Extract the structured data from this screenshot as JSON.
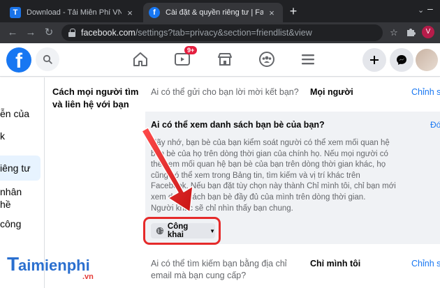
{
  "browser": {
    "tabs": [
      {
        "title": "Download - Tải Miễn Phí VN - Ph",
        "favicon": "T",
        "active": false
      },
      {
        "title": "Cài đặt & quyền riêng tư | Faceb",
        "favicon": "f",
        "active": true
      }
    ],
    "new_tab": "+",
    "close_glyph": "×",
    "url_host": "facebook.com",
    "url_path": "/settings?tab=privacy&section=friendlist&view",
    "profile_initial": "V"
  },
  "fb_header": {
    "logo": "f",
    "watch_badge": "9+"
  },
  "sidebar": {
    "items": [
      "ễn của",
      "k",
      "iêng tư",
      "nhân",
      "hề",
      "công"
    ]
  },
  "settings": {
    "section_title": "Cách mọi người tìm và liên hệ với bạn",
    "q1": {
      "question": "Ai có thể gửi cho bạn lời mời kết bạn?",
      "value": "Mọi người",
      "edit": "Chỉnh s"
    },
    "panel": {
      "title": "Ai có thể xem danh sách bạn bè của bạn?",
      "close": "Đó",
      "lines": [
        "Hãy nhớ, bạn bè của bạn kiểm soát người có thể xem mối quan hệ",
        "bạn bè của họ trên dòng thời gian của chính họ. Nếu mọi người có",
        "thể xem mối quan hệ bạn bè của bạn trên dòng thời gian khác, họ",
        "cũng có thể xem trong Bảng tin, tìm kiếm và vị trí khác trên",
        "Facebook. Nếu bạn đặt tùy chọn này thành Chỉ mình tôi, chỉ bạn mới",
        "xem danh sách bạn bè đầy đủ của mình trên dòng thời gian.",
        "Người khác sẽ chỉ nhìn thấy bạn chung."
      ],
      "audience": "Công khai"
    },
    "q3": {
      "question_lines": [
        "Ai có thể tìm kiếm bạn bằng địa chỉ",
        "email mà bạn cung cấp?"
      ],
      "value": "Chỉ mình tôi",
      "edit": "Chỉnh s"
    }
  },
  "watermark": {
    "brand": "aimienphi",
    "suffix": ".vn"
  },
  "colors": {
    "fb_blue": "#1877f2",
    "annotation_red": "#e52a2a",
    "badge_red": "#e41e3f"
  }
}
